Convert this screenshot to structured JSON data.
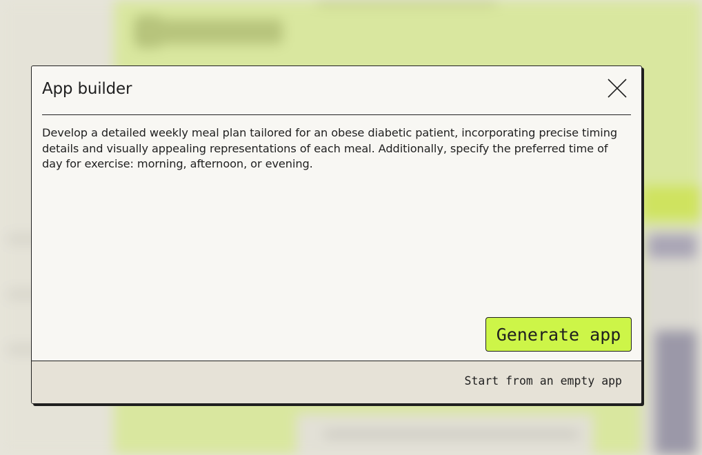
{
  "dialog": {
    "title": "App builder",
    "close_icon": "close-icon",
    "prompt_text": "Develop a detailed weekly meal plan tailored for an obese diabetic patient, incorporating precise timing details and visually appealing representations of each meal. Additionally, specify the preferred time of day for exercise: morning, afternoon, or evening.",
    "generate_label": "Generate app",
    "footer_link": "Start from an empty app"
  },
  "colors": {
    "accent": "#cdf548",
    "dialog_bg": "#f8f7f3",
    "footer_bg": "#e6e2d7",
    "border": "#1f1f1f",
    "backdrop_green": "#d9e79f"
  }
}
